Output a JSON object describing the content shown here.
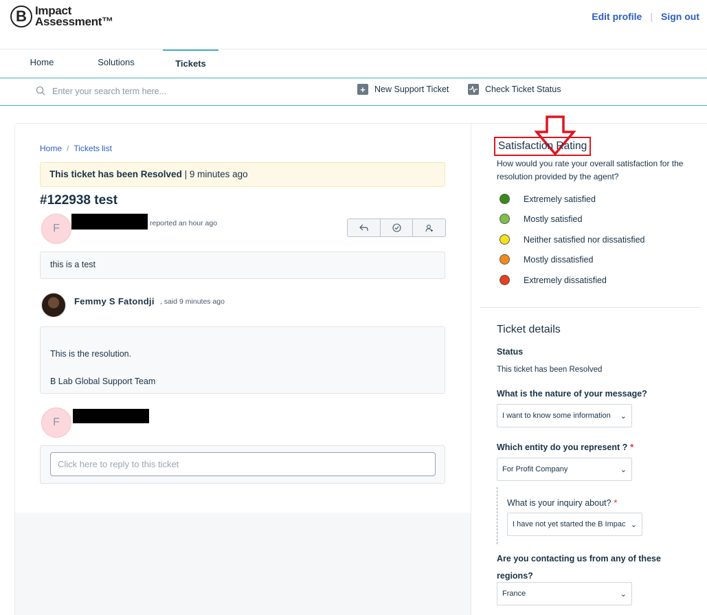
{
  "header": {
    "logo_letter": "B",
    "logo_line1": "Impact",
    "logo_line2": "Assessment™",
    "edit_profile": "Edit profile",
    "separator": "|",
    "sign_out": "Sign out"
  },
  "nav": {
    "tabs": [
      {
        "label": "Home"
      },
      {
        "label": "Solutions"
      },
      {
        "label": "Tickets"
      }
    ]
  },
  "toolbar": {
    "search_placeholder": "Enter your search term here...",
    "new_ticket": "New Support Ticket",
    "check_status": "Check Ticket Status"
  },
  "breadcrumb": {
    "home": "Home",
    "sep": "/",
    "tickets_list": "Tickets list"
  },
  "ticket": {
    "resolved_bold": "This ticket has been Resolved",
    "resolved_rest": " | 9 minutes ago",
    "title": "#122938 test",
    "requester_initial": "F",
    "reported": "reported an hour ago",
    "message": "this is a test",
    "agent_name": "Femmy S Fatondji",
    "agent_said": ", said 9 minutes ago",
    "resolution_line1": "This is the resolution.",
    "resolution_line2": "B Lab Global Support Team",
    "reply_initial": "F",
    "reply_placeholder": "Click here to reply to this ticket"
  },
  "satisfaction": {
    "title": "Satisfaction Rating",
    "description": "How would you rate your overall satisfaction for the resolution provided by the agent?",
    "options": [
      {
        "label": "Extremely satisfied",
        "color": "#3a8a1a"
      },
      {
        "label": "Mostly satisfied",
        "color": "#7cc04a"
      },
      {
        "label": "Neither satisfied nor dissatisfied",
        "color": "#f5e11a"
      },
      {
        "label": "Mostly dissatisfied",
        "color": "#f58a1a"
      },
      {
        "label": "Extremely dissatisfied",
        "color": "#e8401a"
      }
    ]
  },
  "details": {
    "title": "Ticket details",
    "status_label": "Status",
    "status_value": "This ticket has been Resolved",
    "nature_label": "What is the nature of your message?",
    "nature_value": "I want to know some information",
    "entity_label": "Which entity do you represent ?",
    "entity_value": "For Profit Company",
    "inquiry_label": "What is your inquiry about?",
    "inquiry_value": "I have not yet started the B Impac",
    "regions_label_1": "Are you contacting us from any of these",
    "regions_label_2": "regions?",
    "regions_value": "France",
    "required_mark": "*"
  }
}
